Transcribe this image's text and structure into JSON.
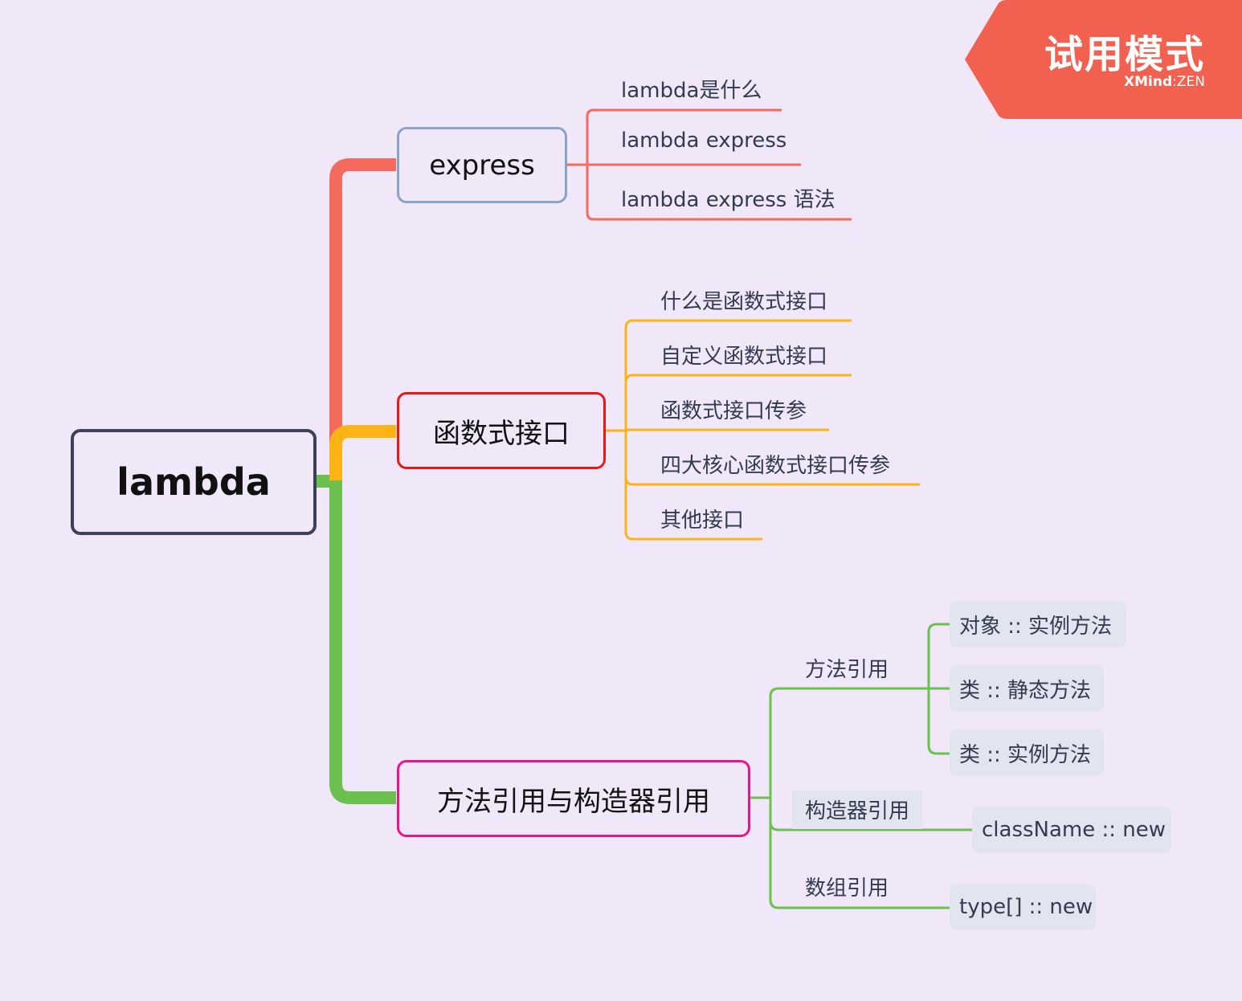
{
  "root": {
    "label": "lambda"
  },
  "branches": [
    {
      "label": "express",
      "color": "#f46a5c",
      "border_color": "#8aa4c8",
      "children": [
        "lambda是什么",
        "lambda express",
        "lambda express 语法"
      ]
    },
    {
      "label": "函数式接口",
      "color": "#fbb414",
      "border_color": "#e81818",
      "children": [
        "什么是函数式接口",
        "自定义函数式接口",
        "函数式接口传参",
        "四大核心函数式接口传参",
        "其他接口"
      ]
    },
    {
      "label": "方法引用与构造器引用",
      "color": "#6cc04e",
      "border_color": "#ea1587",
      "children": [
        {
          "label": "方法引用",
          "items": [
            "对象 :: 实例方法",
            "类 :: 静态方法",
            "类 :: 实例方法"
          ]
        },
        {
          "label": "构造器引用",
          "items": [
            "className :: new"
          ]
        },
        {
          "label": "数组引用",
          "items": [
            "type[] :: new"
          ]
        }
      ]
    }
  ],
  "watermark": {
    "title": "试用模式",
    "brand": "XMind",
    "suffix": "ZEN",
    "color": "#f2604f"
  }
}
